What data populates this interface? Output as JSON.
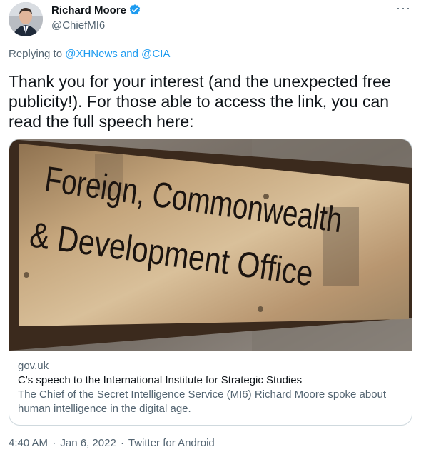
{
  "author": {
    "display_name": "Richard Moore",
    "handle": "@ChiefMI6",
    "verified": true
  },
  "more_icon": "ellipsis-icon",
  "reply": {
    "prefix": "Replying to",
    "mention1": "@XHNews",
    "joiner": "and",
    "mention2": "@CIA"
  },
  "tweet": {
    "text": "Thank you for your interest (and the unexpected free publicity!). For those able to access the link, you can read the full speech here:"
  },
  "card": {
    "sign_text_line1": "Foreign, Commonwealth",
    "sign_text_line2": "& Development Office",
    "domain": "gov.uk",
    "title": "C's speech to the International Institute for Strategic Studies",
    "description": "The Chief of the Secret Intelligence Service (MI6) Richard Moore spoke about human intelligence in the digital age."
  },
  "footer": {
    "time": "4:40 AM",
    "date": "Jan 6, 2022",
    "source": "Twitter for Android",
    "separator": "·"
  },
  "colors": {
    "link": "#1d9bf0",
    "secondary": "#536471",
    "border": "#cfd9de"
  }
}
